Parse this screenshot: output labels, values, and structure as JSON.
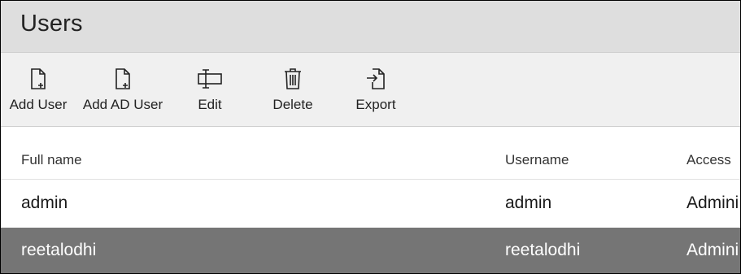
{
  "page": {
    "title": "Users"
  },
  "toolbar": {
    "buttons": [
      {
        "label": "Add User",
        "icon": "add-user-icon"
      },
      {
        "label": "Add AD User",
        "icon": "add-ad-user-icon"
      },
      {
        "label": "Edit",
        "icon": "edit-icon"
      },
      {
        "label": "Delete",
        "icon": "trash-icon"
      },
      {
        "label": "Export",
        "icon": "export-icon"
      }
    ]
  },
  "table": {
    "columns": [
      "Full name",
      "Username",
      "Access"
    ],
    "rows": [
      {
        "full_name": "admin",
        "username": "admin",
        "access": "Admini",
        "selected": false
      },
      {
        "full_name": "reetalodhi",
        "username": "reetalodhi",
        "access": "Admini",
        "selected": true
      }
    ]
  },
  "colors": {
    "title_bar": "#dedede",
    "toolbar": "#f0f0f0",
    "selected_row": "#757575"
  }
}
